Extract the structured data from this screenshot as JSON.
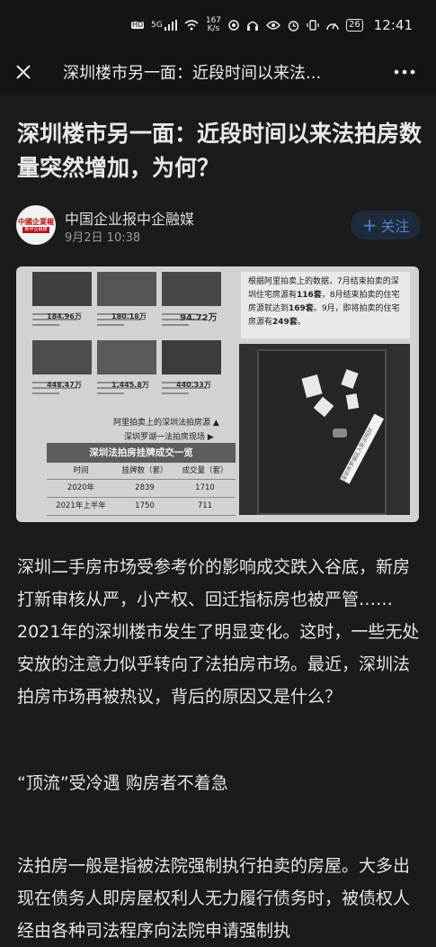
{
  "status_bar": {
    "hd": "HD",
    "signal": "5G",
    "net_speed": "167",
    "net_unit": "K/s",
    "battery": "26",
    "time": "12:41"
  },
  "nav": {
    "title": "深圳楼市另一面：近段时间以来法..."
  },
  "article": {
    "title": "深圳楼市另一面：近段时间以来法拍房数量突然增加，为何？",
    "author": "中国企业报中企融媒",
    "date": "9月2日 10:38",
    "follow_label": "关注",
    "avatar_text_top": "中國企業報",
    "avatar_text_bottom": "新中企融媒"
  },
  "image": {
    "thumb_prices": [
      "184.96万",
      "180.18万",
      "94.72万",
      "448.47万",
      "1,445.8万",
      "440.33万"
    ],
    "caption_1": "阿里拍卖上的深圳法拍房源",
    "caption_2": "深圳罗湖一法拍房现场",
    "quote_pre": "根据阿里拍卖上的数据，7月结束拍卖的深圳住宅房源有",
    "quote_n1": "116套",
    "quote_mid": "，8月结束拍卖的住宅房源就达到",
    "quote_n2": "169套",
    "quote_mid2": "。9月，即将拍卖的住宅房源有",
    "quote_n3": "249套",
    "quote_end": "。",
    "table": {
      "title": "深圳法拍房挂牌成交一览",
      "headers": [
        "时间",
        "挂牌数（套）",
        "成交量（套）"
      ],
      "rows": [
        [
          "2020年",
          "2839",
          "1710"
        ],
        [
          "2021年上半年",
          "1750",
          "711"
        ]
      ]
    },
    "seal_text": "深圳市罗湖区人民法院封"
  },
  "body": {
    "para_1": "深圳二手房市场受参考价的影响成交跌入谷底，新房打新审核从严，小产权、回迁指标房也被严管……2021年的深圳楼市发生了明显变化。这时，一些无处安放的注意力似乎转向了法拍房市场。最近，深圳法拍房市场再被热议，背后的原因又是什么？",
    "subhead": "“顶流”受冷遇 购房者不着急",
    "para_2": "法拍房一般是指被法院强制执行拍卖的房屋。大多出现在债务人即房屋权利人无力履行债务时，被债权人经由各种司法程序向法院申请强制执"
  }
}
